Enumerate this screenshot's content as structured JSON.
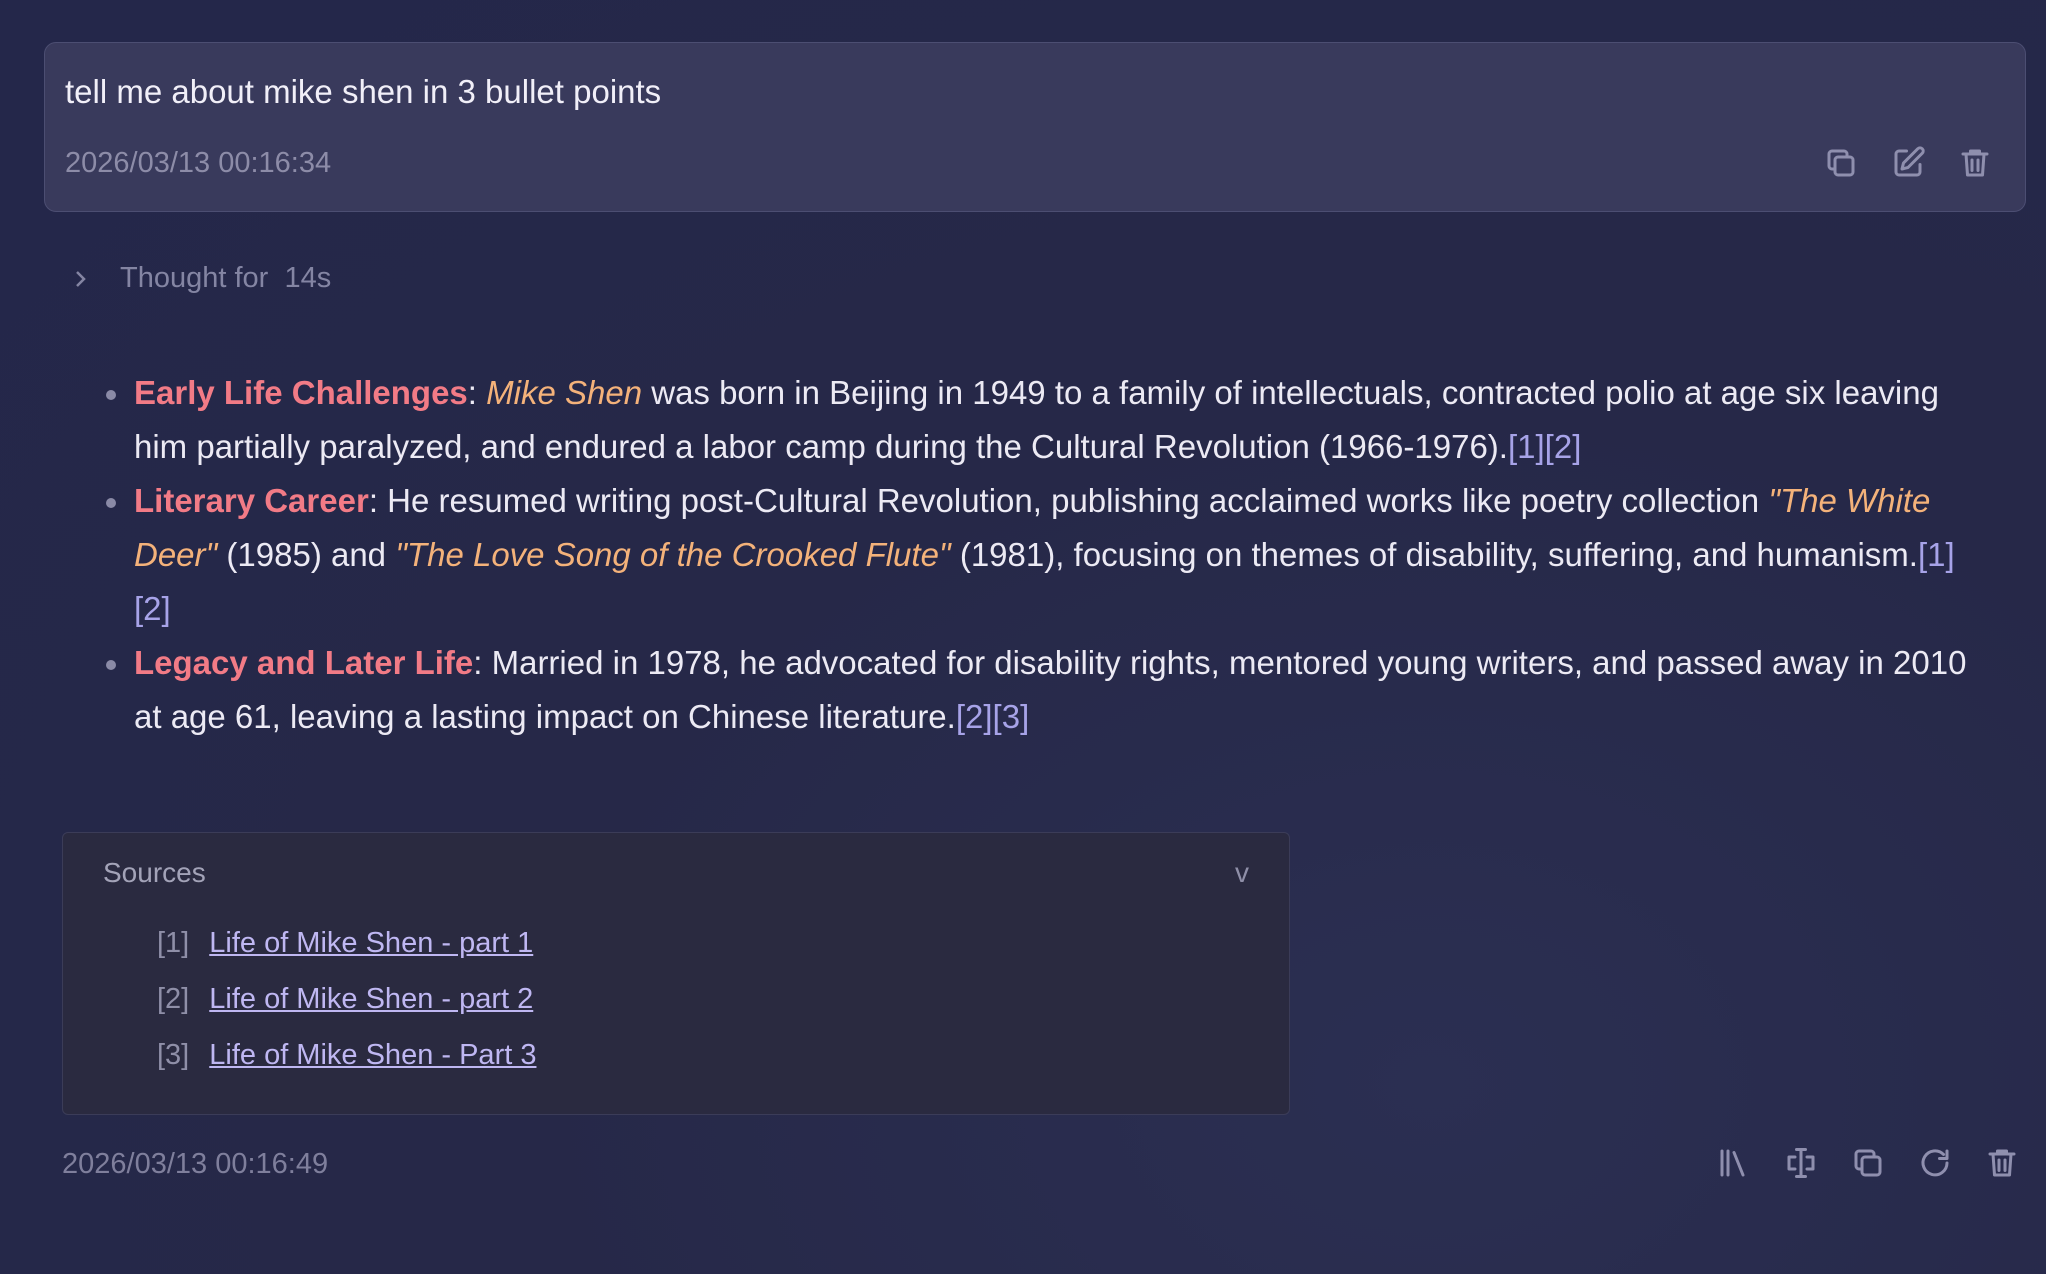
{
  "user_message": {
    "text": "tell me about mike shen in 3 bullet points",
    "timestamp": "2026/03/13 00:16:34",
    "actions": [
      "copy-icon",
      "edit-icon",
      "trash-icon"
    ]
  },
  "thought": {
    "label": "Thought for",
    "duration": "14s"
  },
  "answer": {
    "bullets": [
      {
        "term": "Early Life Challenges",
        "sep": ":",
        "name": "Mike Shen",
        "text": " was born in Beijing in 1949 to a family of intellectuals, contracted polio at age six leaving him partially paralyzed, and endured a labor camp during the Cultural Revolution (1966-1976).",
        "citations": [
          "1",
          "2"
        ]
      },
      {
        "term": "Literary Career",
        "text1": ": He resumed writing post-Cultural Revolution, publishing acclaimed works like poetry collection ",
        "work1": "\"The White Deer\"",
        "text2": " (1985) and ",
        "work2": "\"The Love Song of the Crooked Flute\"",
        "text3": " (1981), focusing on themes of disability, suffering, and humanism.",
        "citations": [
          "1",
          "2"
        ]
      },
      {
        "term": "Legacy and Later Life",
        "text": ": Married in 1978, he advocated for disability rights, mentored young writers, and passed away in 2010 at age 61, leaving a lasting impact on Chinese literature.",
        "citations": [
          "2",
          "3"
        ]
      }
    ]
  },
  "sources": {
    "title": "Sources",
    "toggle": "v",
    "items": [
      {
        "num": "[1]",
        "label": "Life of Mike Shen - part 1"
      },
      {
        "num": "[2]",
        "label": "Life of Mike Shen - part 2"
      },
      {
        "num": "[3]",
        "label": "Life of Mike Shen - Part 3"
      }
    ]
  },
  "assistant_timestamp": "2026/03/13 00:16:49",
  "assistant_actions": [
    "library-icon",
    "translate-icon",
    "copy-icon",
    "regenerate-icon",
    "trash-icon"
  ]
}
